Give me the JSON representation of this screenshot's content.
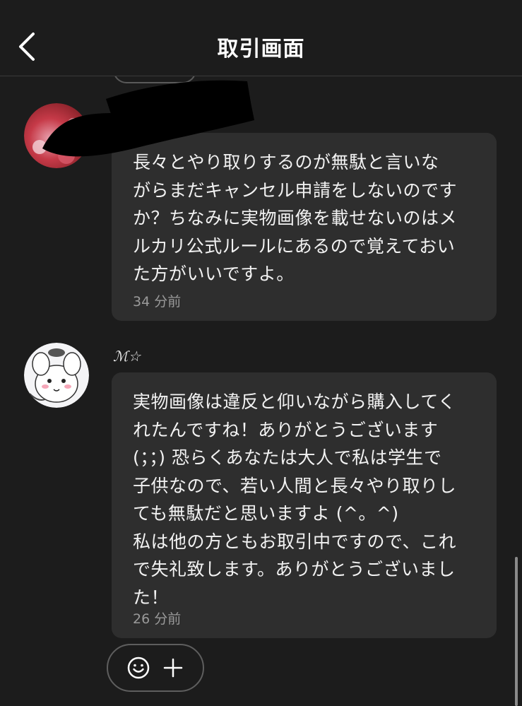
{
  "header": {
    "title": "取引画面"
  },
  "messages": [
    {
      "sender": "",
      "text": "長々とやり取りするのが無駄と言いな\nがらまだキャンセル申請をしないのです\nか？ちなみに実物画像を載せないのはメ\nルカリ公式ルールにあるので覚えておい\nた方がいいですよ。",
      "time": "34 分前"
    },
    {
      "sender": "ℳ☆",
      "text": "実物画像は違反と仰いながら購入してく\nれたんですね！ありがとうございます\n(；；) 恐らくあなたは大人で私は学生で\n子供なので、若い人間と長々やり取りし\nても無駄だと思いますよ (^。^)\n私は他の方ともお取引中ですので、これ\nで失礼致します。ありがとうございまし\nた！",
      "time": "26 分前"
    }
  ],
  "icons": {
    "back": "chevron-left-icon",
    "emoji": "smiley-icon",
    "add": "plus-icon"
  },
  "colors": {
    "background": "#1c1c1c",
    "bubble": "#2e2e2e",
    "text": "#f2f2f2",
    "timestamp": "#9a9a9a"
  }
}
